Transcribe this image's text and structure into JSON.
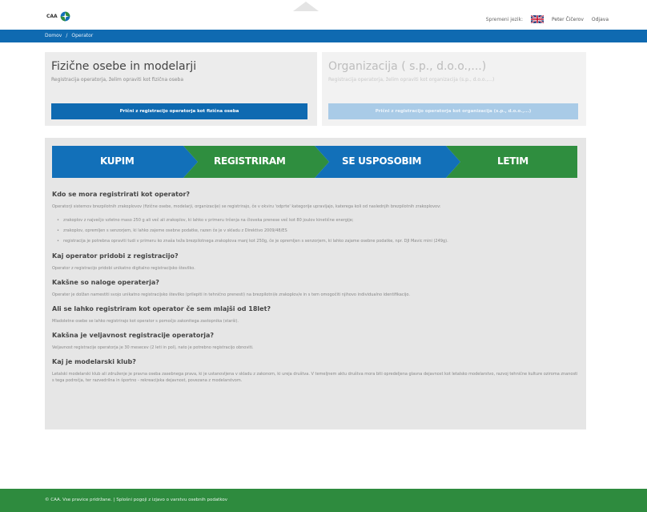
{
  "header": {
    "logo_text": "CAA",
    "language_label": "Spremeni jezik:",
    "flag_icon": "uk-flag-icon",
    "user_name": "Peter Čičerov",
    "logout_label": "Odjava"
  },
  "breadcrumb": {
    "home": "Domov",
    "separator": "/",
    "current": "Operator"
  },
  "cards": {
    "individual": {
      "title": "Fizične osebe in modelarji",
      "subtitle": "Registracija operatorja, želim opraviti kot fizična oseba",
      "button": "Prični z registracijo operatorja kot fizična oseba"
    },
    "organization": {
      "title": "Organizacija ( s.p., d.o.o.,...)",
      "subtitle": "Registracija operatorja, želim opraviti kot organizacija (s.p., d.o.o.,...)",
      "button": "Prični z registracijo operatorja kot organizacija (s.p., d.o.o.,...)"
    }
  },
  "steps": [
    {
      "label": "KUPIM",
      "color": "#1270b9"
    },
    {
      "label": "REGISTRIRAM",
      "color": "#2f8e3f"
    },
    {
      "label": "SE USPOSOBIM",
      "color": "#1270b9"
    },
    {
      "label": "LETIM",
      "color": "#2f8e3f"
    }
  ],
  "faq": {
    "q1": "Kdo se mora registrirati kot operator?",
    "a1": "Operatorji sistemov brezpilotnih zrakoplovov (fizične osebe, modelarji, organizacije) se registrirajo, če v okviru 'odprte' kategorije upravljajo, katerega koli od naslednjih brezpilotnih zrakoplovov:",
    "bullets": [
      "zrakoplov z največjo vzletno maso 250 g ali več ali zrakoplov, ki lahko v primeru trčenja na človeka prenese več kot 80 joulov kinetične energije;",
      "zrakoplov, opremljen s senzorjem, ki lahko zajeme osebne podatke, razen če je v skladu z Direktivo 2009/48/ES",
      "registracija je potrebna opraviti tudi v primeru ko znaša teža brezpilotnega zrakoplova manj kot 250g, če je opremljen s senzorjem, ki lahko zajame osebne podatke, npr. DJI Mavic mini (249g)."
    ],
    "q2": "Kaj operator pridobi z registracijo?",
    "a2": "Operator z registracijo pridobi unikatno digitalno registracijsko številko.",
    "q3": "Kakšne so naloge operaterja?",
    "a3": "Operater je dolžan namestiti svojo unikatno registracijsko številko (prilepiti in tehnično prenesti) na brezpilotni/e zrakoplov/e in s tem omogočiti njihovo individualno identifikacijo.",
    "q4": "Ali se lahko registriram kot operator če sem mlajši od 18let?",
    "a4": "Mladoletne osebe se lahko registrirajo kot operator s pomočjo zakonitega zastopnika (starši).",
    "q5": "Kakšna je veljavnost registracije operatorja?",
    "a5": "Veljavnost registracije operatorja je 30 mesecev (2 leti in pol), nato je potrebno registracijo obnoviti.",
    "q6": "Kaj je modelarski klub?",
    "a6": "Letalski modelarski klub ali združenje je pravna oseba zasebnega prava, ki je ustanovljena v skladu z zakonom, ki ureja društva. V temeljnem aktu društva mora biti opredeljena glavna dejavnost kot letalsko modelarstvo, razvoj tehnične kulture oziroma znanosti s tega področja, ter razvedrilna in športno - rekreacijska dejavnost, povezana z modelarstvom."
  },
  "footer": {
    "copyright": "© CAA. Vse pravice pridržane.",
    "separator": "|",
    "terms_link": "Splošni pogoji z izjavo o varstvu osebnih podatkov"
  }
}
